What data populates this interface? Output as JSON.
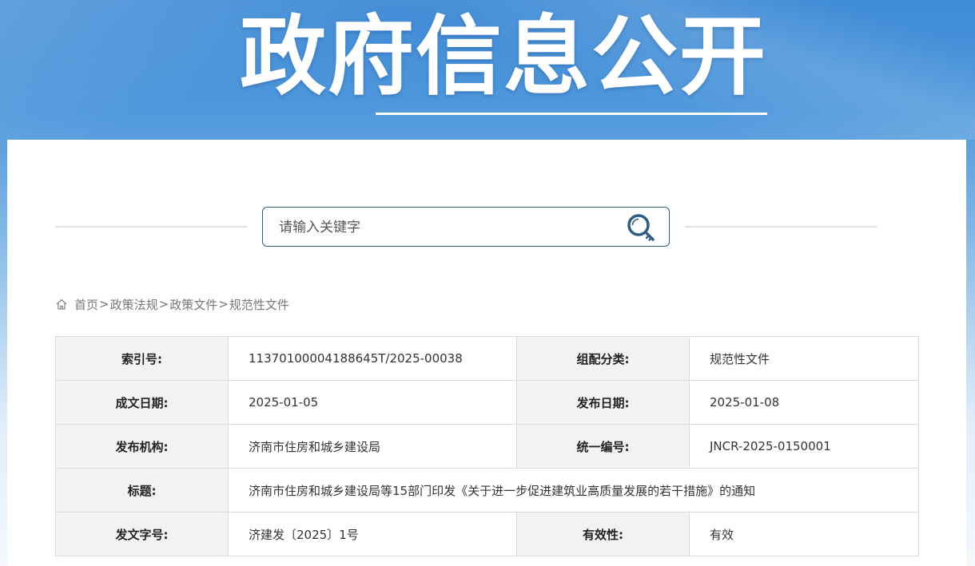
{
  "banner": {
    "title": "政府信息公开"
  },
  "search": {
    "placeholder": "请输入关键字"
  },
  "breadcrumb": {
    "items": [
      "首页",
      "政策法规",
      "政策文件",
      "规范性文件"
    ],
    "separator": ">"
  },
  "info": {
    "index_label": "索引号:",
    "index_value": "11370100004188645T/2025-00038",
    "category_label": "组配分类:",
    "category_value": "规范性文件",
    "written_date_label": "成文日期:",
    "written_date_value": "2025-01-05",
    "publish_date_label": "发布日期:",
    "publish_date_value": "2025-01-08",
    "publisher_label": "发布机构:",
    "publisher_value": "济南市住房和城乡建设局",
    "unified_no_label": "统一编号:",
    "unified_no_value": "JNCR-2025-0150001",
    "title_label": "标题:",
    "title_value": "济南市住房和城乡建设局等15部门印发《关于进一步促进建筑业高质量发展的若干措施》的通知",
    "doc_no_label": "发文字号:",
    "doc_no_value": "济建发〔2025〕1号",
    "validity_label": "有效性:",
    "validity_value": "有效"
  },
  "colors": {
    "banner_blue": "#3f8bd6",
    "border_navy": "#2f5f86",
    "label_bg": "#f2f2f2"
  }
}
